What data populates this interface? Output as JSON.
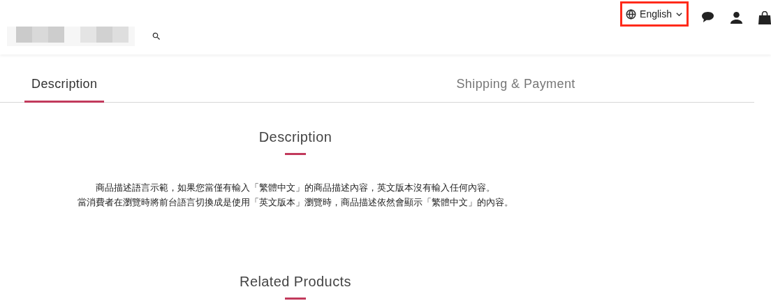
{
  "header": {
    "language": {
      "label": "English",
      "highlighted": true
    }
  },
  "tabs": [
    {
      "label": "Description",
      "selected": true
    },
    {
      "label": "Shipping & Payment",
      "selected": false
    }
  ],
  "description": {
    "title": "Description",
    "lines": [
      "商品描述語言示範，如果您當僅有輸入「繁體中文」的商品描述內容，英文版本沒有輸入任何內容。",
      "當消費者在瀏覽時將前台語言切換成是使用「英文版本」瀏覽時，商品描述依然會顯示「繁體中文」的內容。"
    ]
  },
  "related": {
    "title": "Related Products"
  }
}
